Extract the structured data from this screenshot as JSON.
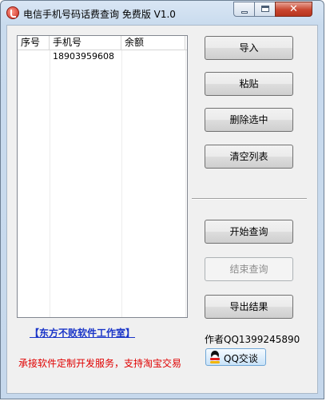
{
  "window": {
    "title": "电信手机号码话费查询 免费版 V1.0",
    "controls": {
      "minimize": "minimize",
      "maximize": "maximize",
      "close": "✕"
    }
  },
  "table": {
    "columns": [
      "序号",
      "手机号",
      "余额"
    ],
    "rows": [
      {
        "seq": "",
        "phone": "18903959608",
        "balance": ""
      }
    ]
  },
  "buttons": {
    "import": "导入",
    "paste": "粘贴",
    "delete_selected": "删除选中",
    "clear_list": "清空列表",
    "start_query": "开始查询",
    "end_query": "结束查询",
    "export_results": "导出结果"
  },
  "footer": {
    "studio_link": "【东方不败软件工作室】",
    "service_text": "承接软件定制开发服务，支持淘宝交易",
    "author": "作者QQ1399245890",
    "qq_button": "QQ交谈"
  },
  "colors": {
    "link": "#1a35c8",
    "service_text": "#e00000",
    "disabled_text": "#8d8d8d"
  }
}
